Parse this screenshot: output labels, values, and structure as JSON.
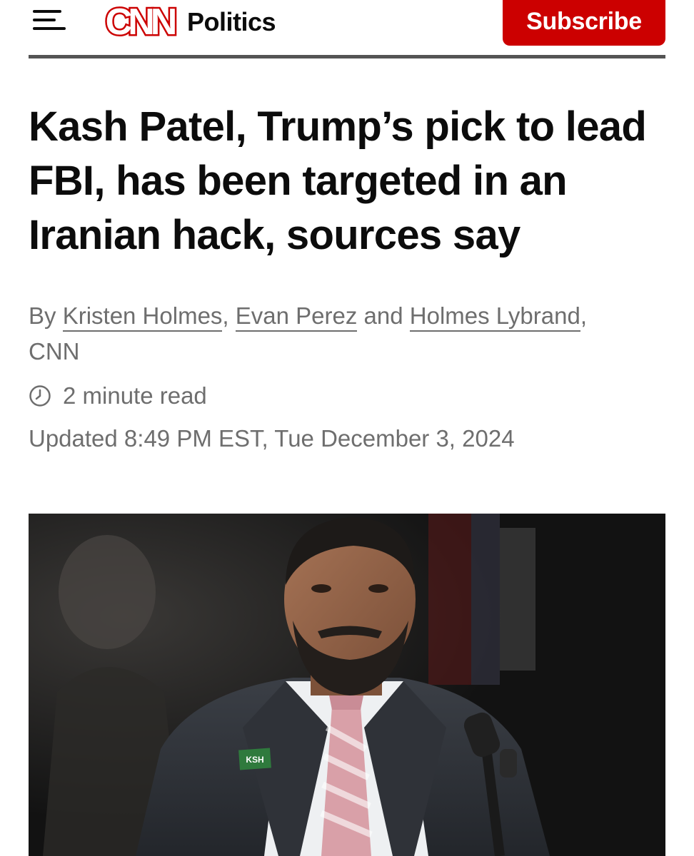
{
  "header": {
    "logo_text": "CNN",
    "section": "Politics",
    "subscribe_label": "Subscribe"
  },
  "article": {
    "headline": "Kash Patel, Trump’s pick to lead FBI, has been targeted in an Iranian hack, sources say",
    "byline": {
      "prefix": "By",
      "authors": [
        "Kristen Holmes",
        "Evan Perez",
        "Holmes Lybrand"
      ],
      "separator1": ",",
      "separator2": "and",
      "suffix": ",",
      "outlet": "CNN"
    },
    "read_time": "2 minute read",
    "updated": "Updated 8:49 PM EST, Tue December 3, 2024"
  },
  "photo": {
    "pin_text": "KSH"
  },
  "colors": {
    "brand_red": "#cc0000",
    "meta_gray": "#6e6e6e"
  },
  "icons": [
    "menu-icon",
    "clock-icon"
  ]
}
